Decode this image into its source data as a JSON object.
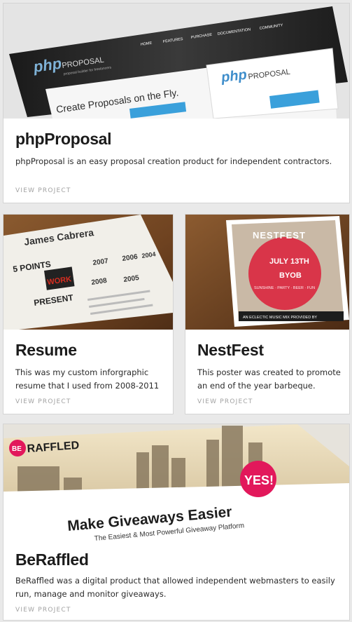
{
  "cards": [
    {
      "title": "phpProposal",
      "description": "phpProposal is an easy proposal creation product for independent contractors.",
      "link": "VIEW PROJECT",
      "thumb": {
        "logo_php": "php",
        "logo_word": "PROPOSAL",
        "tagline": "proposal builder for freelancers",
        "nav": [
          "HOME",
          "FEATURES",
          "PURCHASE",
          "DOCUMENTATION",
          "COMMUNITY"
        ],
        "headline": "Create Proposals on the Fly."
      }
    },
    {
      "title": "Resume",
      "description": "This was my custom inforgraphic resume that I used from 2008-2011",
      "link": "VIEW PROJECT",
      "thumb": {
        "name": "James Cabrera",
        "points": "5 POINTS",
        "work": "WORK",
        "present": "PRESENT",
        "years": [
          "2007",
          "2008",
          "2006",
          "2005",
          "2004"
        ]
      }
    },
    {
      "title": "NestFest",
      "description": "This poster was created to promote an end of the year barbeque.",
      "link": "VIEW PROJECT",
      "thumb": {
        "poster_title": "NESTFEST",
        "date": "JULY 13TH",
        "byob": "BYOB",
        "tag": "SUNSHINE · PARTY · BEER · FUN",
        "footer": "AN ECLECTIC MUSIC MIX PROVIDED BY"
      }
    },
    {
      "title": "BeRaffled",
      "description": "BeRaffled was a digital product that allowed independent webmasters to easily run, manage and monitor giveaways.",
      "link": "VIEW PROJECT",
      "thumb": {
        "logo_be": "BE",
        "logo_word": "RAFFLED",
        "headline": "Make Giveaways Easier",
        "subheadline": "The Easiest & Most Powerful Giveaway Platform",
        "badge": "YES!"
      }
    }
  ]
}
